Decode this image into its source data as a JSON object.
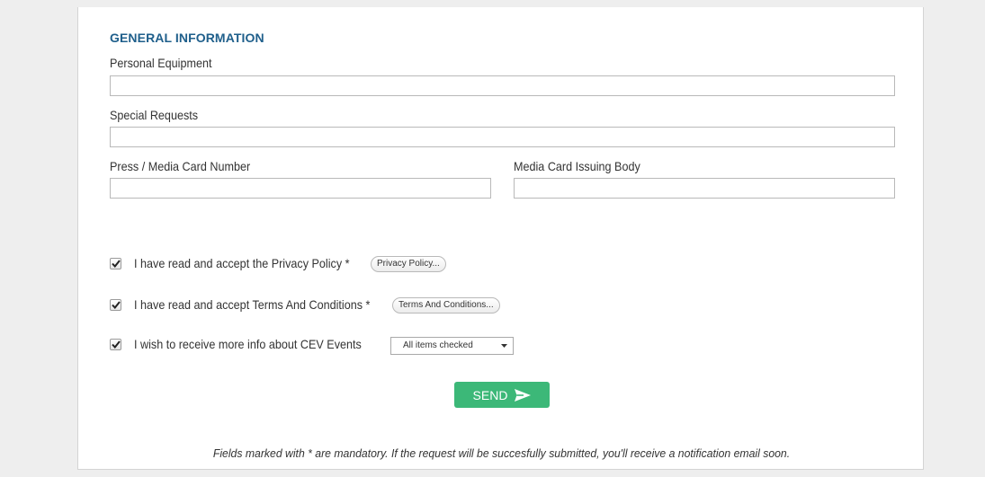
{
  "section": {
    "title": "GENERAL INFORMATION"
  },
  "fields": {
    "personal_equipment": {
      "label": "Personal Equipment",
      "value": ""
    },
    "special_requests": {
      "label": "Special Requests",
      "value": ""
    },
    "press_card_number": {
      "label": "Press / Media Card Number",
      "value": ""
    },
    "card_issuing_body": {
      "label": "Media Card Issuing Body",
      "value": ""
    }
  },
  "consents": {
    "privacy": {
      "label": "I have read and accept the Privacy Policy *",
      "button": "Privacy Policy...",
      "checked": true
    },
    "terms": {
      "label": "I have read and accept Terms And Conditions *",
      "button": "Terms And Conditions...",
      "checked": true
    },
    "info": {
      "label": "I wish to receive more info about CEV Events",
      "select_value": "All items checked",
      "checked": true
    }
  },
  "actions": {
    "send_label": "SEND"
  },
  "footer": {
    "note": "Fields marked with * are mandatory. If the request will be succesfully submitted, you'll receive a notification email soon."
  },
  "colors": {
    "heading": "#1f5f8b",
    "send_button": "#3cb878",
    "page_background": "#eeeeee"
  }
}
